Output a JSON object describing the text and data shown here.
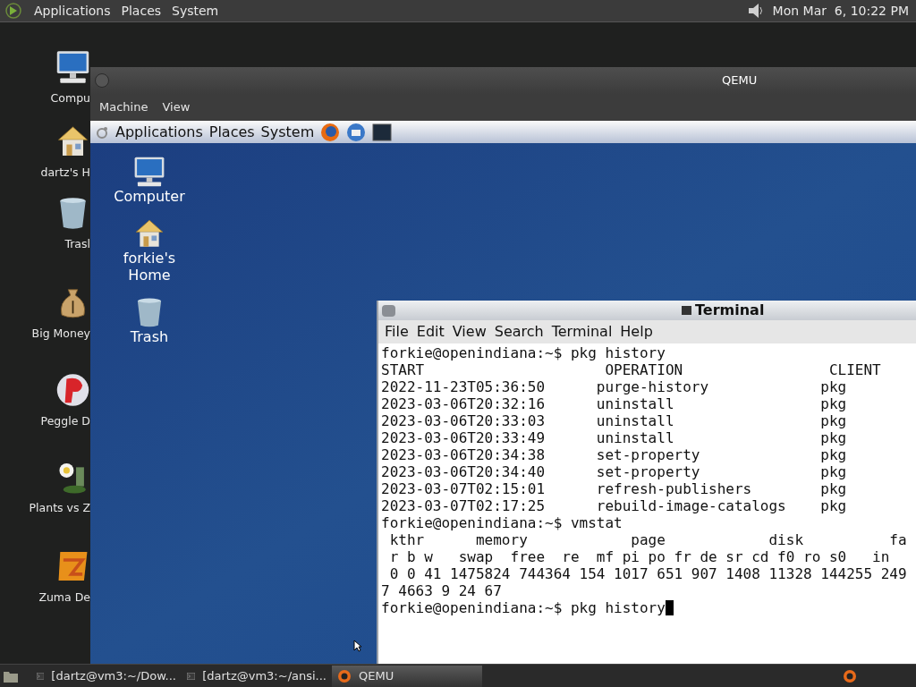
{
  "top_panel": {
    "menus": [
      "Applications",
      "Places",
      "System"
    ],
    "clock": "Mon Mar  6, 10:22 PM"
  },
  "desktop_icons": [
    {
      "kind": "computer",
      "label": "Compu"
    },
    {
      "kind": "home",
      "label": "dartz's H"
    },
    {
      "kind": "trash",
      "label": "Trasl"
    },
    {
      "kind": "money",
      "label": "Big Money"
    },
    {
      "kind": "ball",
      "label": "Peggle D"
    },
    {
      "kind": "plant",
      "label": "Plants vs Z"
    },
    {
      "kind": "block",
      "label": "Zuma De"
    }
  ],
  "qemu_window": {
    "title": "QEMU",
    "menus": [
      "Machine",
      "View"
    ],
    "guest": {
      "panel_menus": [
        "Applications",
        "Places",
        "System"
      ],
      "desktop_icons": [
        {
          "kind": "computer",
          "label": "Computer"
        },
        {
          "kind": "home",
          "label": "forkie's\nHome"
        },
        {
          "kind": "trash",
          "label": "Trash"
        }
      ],
      "terminal": {
        "title": "Terminal",
        "menus": [
          "File",
          "Edit",
          "View",
          "Search",
          "Terminal",
          "Help"
        ],
        "lines": [
          "forkie@openindiana:~$ pkg history",
          "START                     OPERATION                 CLIENT",
          "2022-11-23T05:36:50      purge-history             pkg",
          "2023-03-06T20:32:16      uninstall                 pkg",
          "2023-03-06T20:33:03      uninstall                 pkg",
          "2023-03-06T20:33:49      uninstall                 pkg",
          "2023-03-06T20:34:38      set-property              pkg",
          "2023-03-06T20:34:40      set-property              pkg",
          "2023-03-07T02:15:01      refresh-publishers        pkg",
          "2023-03-07T02:17:25      rebuild-image-catalogs    pkg",
          "forkie@openindiana:~$ vmstat",
          " kthr      memory            page            disk          fa",
          " r b w   swap  free  re  mf pi po fr de sr cd f0 ro s0   in",
          " 0 0 41 1475824 744364 154 1017 651 907 1408 11328 144255 249",
          "7 4663 9 24 67",
          "forkie@openindiana:~$ pkg history"
        ],
        "cursor": true
      }
    }
  },
  "taskbar": {
    "items": [
      {
        "label": "[dartz@vm3:~/Dow...",
        "kind": "terminal",
        "selected": false
      },
      {
        "label": "[dartz@vm3:~/ansi...",
        "kind": "terminal",
        "selected": false
      },
      {
        "label": "QEMU",
        "kind": "qemu",
        "selected": true
      }
    ]
  }
}
